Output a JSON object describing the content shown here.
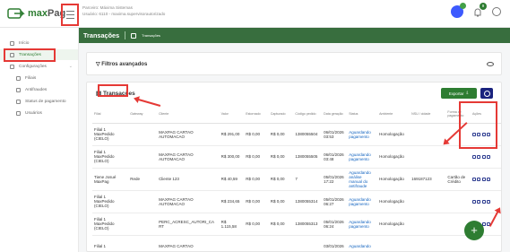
{
  "app": {
    "brand_a": "max",
    "brand_b": "Pag"
  },
  "tenant": {
    "line1": "Parceiro: Máxima Sistemas",
    "line2": "Usuário: 6110 - maxima.supervisorautorizado"
  },
  "header": {
    "notify_count": "9"
  },
  "sidebar": {
    "items": [
      {
        "label": "Início"
      },
      {
        "label": "Transações"
      },
      {
        "label": "Configurações"
      },
      {
        "label": "Filiais"
      },
      {
        "label": "Antifraudes"
      },
      {
        "label": "Status de pagamento"
      },
      {
        "label": "Usuários"
      }
    ]
  },
  "page": {
    "title": "Transações",
    "crumb": "Transações"
  },
  "filters": {
    "title": "Filtros avançados"
  },
  "table_card": {
    "title": "Transações",
    "export_label": "Exportar"
  },
  "table": {
    "columns": [
      "Filial",
      "Gateway",
      "Cliente",
      "Valor",
      "Estornado",
      "Capturado",
      "Código pedido",
      "Data geração",
      "Status",
      "Ambiente",
      "NSU / cidade",
      "Forma de pagamento",
      "Ações"
    ],
    "rows": [
      [
        "Filial 1 MaxPedido (CIELO)",
        "",
        "MAXPAG CARTAO AUTOMACAO",
        "R$ 291,00",
        "R$ 0,00",
        "R$ 0,00",
        "1380055504",
        "06/01/2026 03:53",
        "Aguardando pagamento",
        "Homologação",
        "",
        ""
      ],
      [
        "Filial 1 MaxPedido (CIELO)",
        "",
        "MAXPAG CARTAO AUTOMACAO",
        "R$ 300,00",
        "R$ 0,00",
        "R$ 0,00",
        "1380055505",
        "06/01/2026 03:48",
        "Aguardando pagamento",
        "Homologação",
        "",
        ""
      ],
      [
        "Tiene Josué MaxPag",
        "Rede",
        "Cliente 123",
        "R$ 40,59",
        "R$ 0,00",
        "R$ 0,00",
        "7",
        "05/01/2026 17:22",
        "Aguardando análise manual do antifraude",
        "Homologação",
        "169187123",
        "Cartão de Crédito"
      ],
      [
        "Filial 1 MaxPedido (CIELO)",
        "",
        "MAXPAG CARTAO AUTOMACAO",
        "R$ 234,65",
        "R$ 0,00",
        "R$ 0,00",
        "1380055314",
        "05/01/2026 06:27",
        "Aguardando pagamento",
        "Homologação",
        "",
        ""
      ],
      [
        "Filial 1 MaxPedido (CIELO)",
        "",
        "PERC_ACRESC_AUTORI_CA RT",
        "R$ 1.115,58",
        "R$ 0,00",
        "R$ 0,00",
        "1380055313",
        "05/01/2026 06:24",
        "Aguardando pagamento",
        "Homologação",
        "",
        ""
      ],
      [
        "Filial 1",
        "",
        "MAXPAG CARTAO",
        "",
        "",
        "",
        "",
        "03/01/2026",
        "Aguardando",
        "",
        "",
        ""
      ]
    ]
  }
}
